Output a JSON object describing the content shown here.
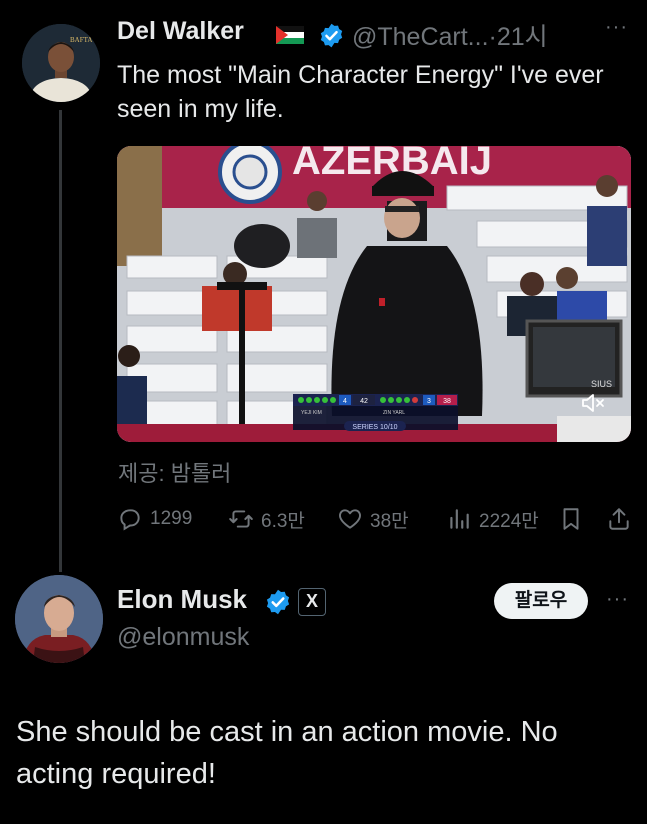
{
  "tweet": {
    "author_name": "Del Walker",
    "author_handle": "@TheCart...",
    "separator": "·",
    "time": "21시",
    "more": "···",
    "text": "The most \"Main Character Energy\" I've ever seen in my life.",
    "media": {
      "banner_text": "AZERBAIJ",
      "scoreboard": {
        "left_score": "42",
        "right_score": "38",
        "left_sets": "4",
        "right_sets": "3",
        "left_name": "YEJI KIM",
        "right_name": "ZIN YARL",
        "series": "SERIES 10/10"
      },
      "monitor_text": "SIUS"
    },
    "credit": "제공: 밤톨러",
    "actions": {
      "replies": "1299",
      "retweets": "6.3만",
      "likes": "38만",
      "views": "2224만"
    },
    "icons": [
      "flag-icon",
      "verified-icon",
      "reply-icon",
      "retweet-icon",
      "like-icon",
      "views-icon",
      "bookmark-icon",
      "share-icon",
      "mute-icon"
    ]
  },
  "reply": {
    "author_name": "Elon Musk",
    "x_badge": "X",
    "author_handle": "@elonmusk",
    "follow_label": "팔로우",
    "more": "···",
    "text": "She should be cast in an action movie. No acting required!"
  },
  "colors": {
    "background": "#000000",
    "text": "#e7e9ea",
    "secondary": "#71767b",
    "verified": "#1d9bf0",
    "follow_bg": "#eff3f4"
  }
}
